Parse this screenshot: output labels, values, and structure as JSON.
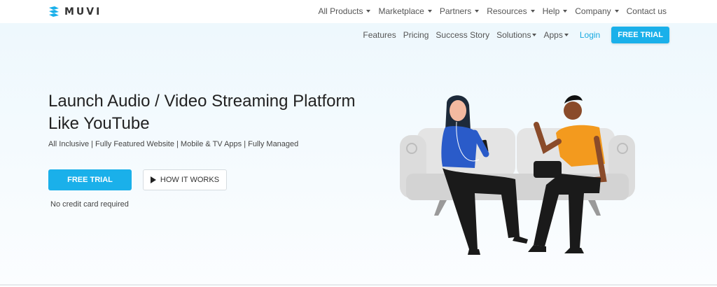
{
  "brand": {
    "name": "MUVI",
    "color": "#1ab0ea",
    "logo_icon": "muvi-logo-icon"
  },
  "topnav": [
    {
      "label": "All Products",
      "dropdown": true
    },
    {
      "label": "Marketplace",
      "dropdown": true
    },
    {
      "label": "Partners",
      "dropdown": true
    },
    {
      "label": "Resources",
      "dropdown": true
    },
    {
      "label": "Help",
      "dropdown": true
    },
    {
      "label": "Company",
      "dropdown": true
    },
    {
      "label": "Contact us",
      "dropdown": false
    }
  ],
  "subnav": {
    "items": [
      {
        "label": "Features",
        "dropdown": false
      },
      {
        "label": "Pricing",
        "dropdown": false
      },
      {
        "label": "Success Story",
        "dropdown": false
      },
      {
        "label": "Solutions",
        "dropdown": true
      },
      {
        "label": "Apps",
        "dropdown": true
      }
    ],
    "login": "Login",
    "trial": "FREE TRIAL"
  },
  "hero": {
    "title_line1": "Launch Audio / Video Streaming Platform",
    "title_line2": "Like YouTube",
    "subtitle": "All Inclusive | Fully Featured Website | Mobile & TV Apps | Fully Managed",
    "cta_primary": "FREE TRIAL",
    "cta_secondary": "HOW IT WORKS",
    "note": "No credit card required"
  },
  "colors": {
    "accent": "#1ab0ea",
    "hero_bg": "#eef8fd",
    "text": "#222222"
  }
}
